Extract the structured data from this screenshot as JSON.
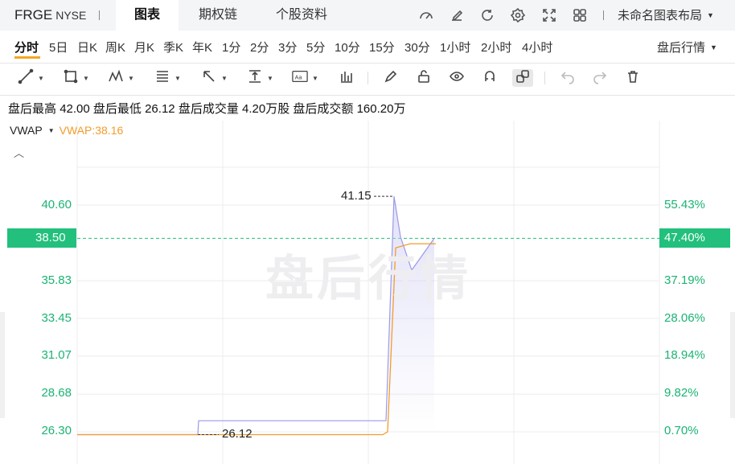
{
  "header": {
    "ticker": "FRGE",
    "exchange": "NYSE",
    "tabs": [
      {
        "label": "图表",
        "active": true
      },
      {
        "label": "期权链",
        "active": false
      },
      {
        "label": "个股资料",
        "active": false
      }
    ],
    "icons": [
      "gauge-icon",
      "edit-icon",
      "refresh-icon",
      "settings-icon",
      "fullscreen-icon",
      "grid-layout-icon"
    ],
    "layout_label": "未命名图表布局"
  },
  "periods": {
    "items": [
      "分时",
      "5日",
      "日K",
      "周K",
      "月K",
      "季K",
      "年K",
      "1分",
      "2分",
      "3分",
      "5分",
      "10分",
      "15分",
      "30分",
      "1小时",
      "2小时",
      "4小时"
    ],
    "active": "分时",
    "session_label": "盘后行情"
  },
  "toolbar": {
    "tools": [
      "line-tool-icon",
      "rectangle-tool-icon",
      "pattern-tool-icon",
      "fibonacci-tool-icon",
      "arrow-tool-icon",
      "measure-tool-icon",
      "text-tool-icon",
      "indicator-icon",
      "pen-icon",
      "lock-icon",
      "eye-icon",
      "magnet-icon",
      "link-icon",
      "undo-icon",
      "redo-icon",
      "trash-icon"
    ]
  },
  "stats": {
    "high_label": "盘后最高",
    "high": "42.00",
    "low_label": "盘后最低",
    "low": "26.12",
    "volume_label": "盘后成交量",
    "volume": "4.20万股",
    "turnover_label": "盘后成交额",
    "turnover": "160.20万"
  },
  "indicator": {
    "name": "VWAP",
    "value_text": "VWAP:38.16"
  },
  "chart": {
    "watermark": "盘后行情",
    "current_price": "38.50",
    "current_pct": "47.40%",
    "high_marker": "41.15",
    "low_marker": "26.12",
    "colors": {
      "price": "#9a9ae8",
      "vwap": "#f29c2b",
      "axis_text": "#1bb374",
      "current_bg": "#22c07c"
    }
  },
  "chart_data": {
    "type": "line",
    "y_left_ticks": [
      "40.60",
      "35.83",
      "33.45",
      "31.07",
      "28.68",
      "26.30"
    ],
    "y_right_ticks": [
      "55.43%",
      "37.19%",
      "28.06%",
      "18.94%",
      "9.82%",
      "0.70%"
    ],
    "ylim": [
      26.3,
      40.6
    ],
    "series": [
      {
        "values": [
          26.12,
          26.12,
          27.0,
          27.0,
          41.15,
          38.6,
          36.5,
          38.5
        ]
      },
      {
        "name": "VWAP",
        "values": [
          26.12,
          26.12,
          26.12,
          26.12,
          26.3,
          37.9,
          38.16,
          38.16
        ]
      }
    ]
  }
}
